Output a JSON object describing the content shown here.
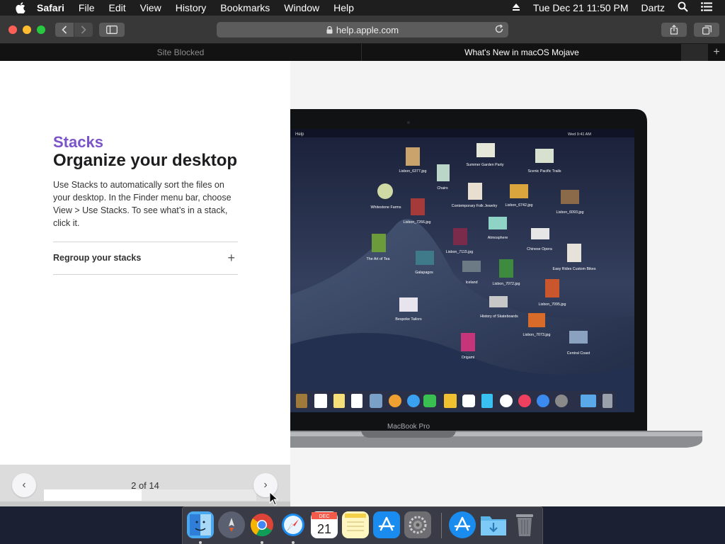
{
  "menubar": {
    "app_name": "Safari",
    "items": [
      "File",
      "Edit",
      "View",
      "History",
      "Bookmarks",
      "Window",
      "Help"
    ],
    "clock": "Tue Dec 21  11:50 PM",
    "user": "Dartz"
  },
  "browser": {
    "url": "help.apple.com",
    "tabs": [
      {
        "label": "Site Blocked",
        "active": false
      },
      {
        "label": "What's New in macOS Mojave",
        "active": true
      }
    ],
    "new_tab_label": "+"
  },
  "article": {
    "eyebrow": "Stacks",
    "headline": "Organize your desktop",
    "body": "Use Stacks to automatically sort the files on your desktop. In the Finder menu bar, choose View > Use Stacks. To see what’s in a stack, click it.",
    "accordion_label": "Regroup your stacks",
    "accordion_icon": "+"
  },
  "pager": {
    "label": "2 of 14",
    "prev_icon": "‹",
    "next_icon": "›",
    "progress": 0.46
  },
  "laptop": {
    "brand_label": "MacBook Pro",
    "screen_menu_app": "Help",
    "screen_clock": "Wed 9:41 AM",
    "desktop_files": [
      "Lisbon_6377.jpg",
      "Summer Garden Party",
      "Scenic Pacific Trails",
      "Chairs",
      "Whitestone Farms",
      "Contemporary Folk Jewelry",
      "Lisbon_6742.jpg",
      "Lisbon_6093.jpg",
      "Lisbon_7266.jpg",
      "Atmosphere",
      "Chinese Opera",
      "The Art of Tea",
      "Lisbon_7115.jpg",
      "Easy Rides Custom Bikes",
      "Galapagos",
      "Iceland",
      "Lisbon_7072.jpg",
      "Lisbon_7095.jpg",
      "Bespoke Tailors",
      "History of Skateboards",
      "Lisbon_7073.jpg",
      "Central Coast",
      "Origami"
    ]
  },
  "dock": {
    "apps": [
      "finder-icon",
      "launchpad-icon",
      "chrome-icon",
      "safari-icon",
      "calendar-icon",
      "notes-icon",
      "app-store-icon",
      "system-preferences-icon",
      "app-store-download-icon",
      "downloads-folder-icon",
      "trash-icon"
    ],
    "calendar_month": "DEC",
    "calendar_day": "21"
  },
  "colors": {
    "eyebrow": "#7b54c9",
    "menubar": "#1e1e1e",
    "toolbar": "#383838",
    "tabbar": "#121212"
  }
}
